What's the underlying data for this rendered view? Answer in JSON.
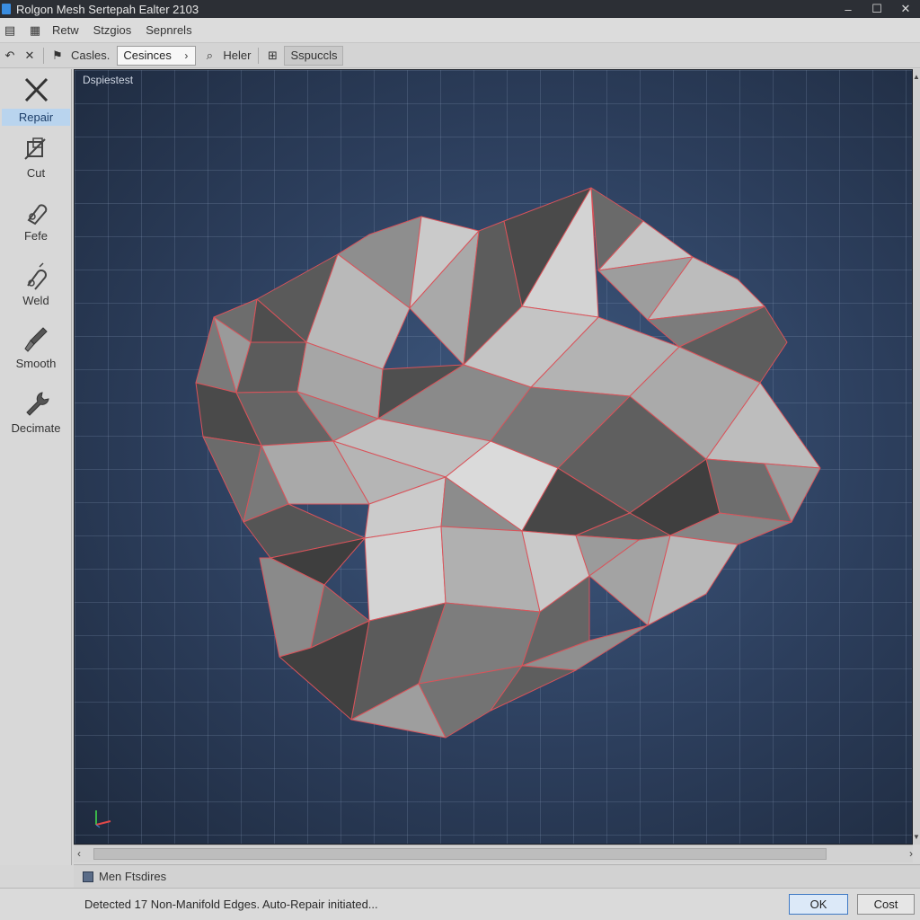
{
  "window": {
    "title": "Rolgon Mesh Sertepah Ealter 2103",
    "controls": [
      "–",
      "☐",
      "✕"
    ]
  },
  "menu": {
    "items": [
      "Retw",
      "Stzgios",
      "Sepnrels"
    ]
  },
  "toolbar": {
    "cases_label": "Casles.",
    "dropdown_value": "Cesinces",
    "helper_label": "Heler",
    "chip_label": "Sspuccls"
  },
  "tools": [
    {
      "label": "Repair",
      "icon": "repair-cross-icon",
      "active": true
    },
    {
      "label": "Cut",
      "icon": "cut-icon",
      "active": false
    },
    {
      "label": "Fefe",
      "icon": "fefe-icon",
      "active": false
    },
    {
      "label": "Weld",
      "icon": "weld-icon",
      "active": false
    },
    {
      "label": "Smooth",
      "icon": "smooth-brush-icon",
      "active": false
    },
    {
      "label": "Decimate",
      "icon": "decimate-wrench-icon",
      "active": false
    }
  ],
  "viewport": {
    "label": "Dspiestest",
    "background": "#2c3e5c",
    "edge_highlight": "#e04848"
  },
  "properties": {
    "label": "Men Ftsdires"
  },
  "status": {
    "message": "Detected 17 Non-Manifold Edges. Auto-Repair initiated...",
    "ok_label": "OK",
    "cancel_label": "Cost"
  }
}
